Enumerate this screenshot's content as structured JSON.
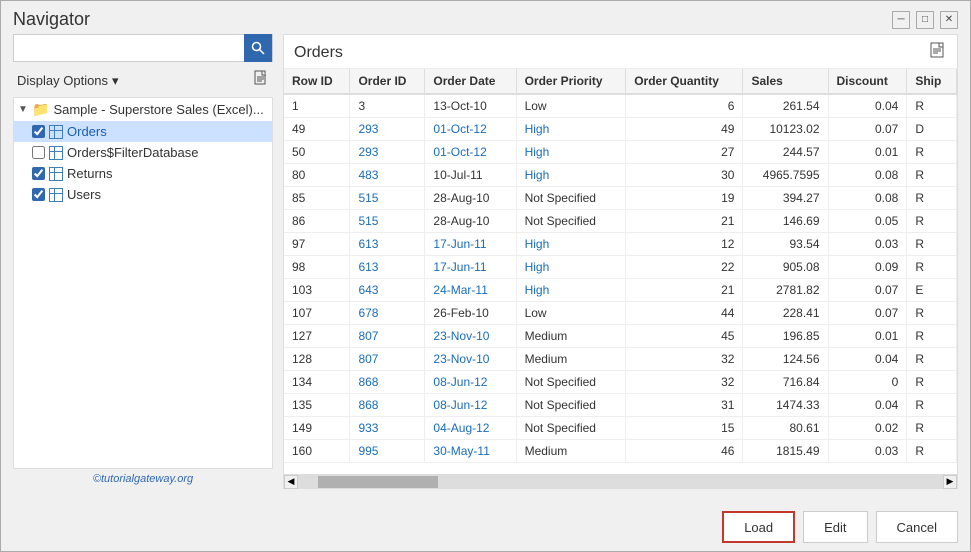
{
  "window": {
    "title": "Navigator",
    "minimize_label": "─",
    "restore_label": "□",
    "close_label": "✕"
  },
  "left_panel": {
    "search_placeholder": "",
    "display_options_label": "Display Options",
    "display_options_arrow": "▾",
    "nav_icon": "📄",
    "tree": {
      "root": {
        "label": "Sample - Superstore Sales (Excel)...",
        "expanded": true
      },
      "items": [
        {
          "id": "orders",
          "label": "Orders",
          "checked": true,
          "selected": true
        },
        {
          "id": "orders-filter",
          "label": "Orders$FilterDatabase",
          "checked": false,
          "selected": false
        },
        {
          "id": "returns",
          "label": "Returns",
          "checked": true,
          "selected": false
        },
        {
          "id": "users",
          "label": "Users",
          "checked": true,
          "selected": false
        }
      ]
    },
    "watermark": "©tutorialgateway.org"
  },
  "right_panel": {
    "title": "Orders",
    "columns": [
      "Row ID",
      "Order ID",
      "Order Date",
      "Order Priority",
      "Order Quantity",
      "Sales",
      "Discount",
      "Ship"
    ],
    "rows": [
      {
        "row_id": "1",
        "order_id": "3",
        "order_date": "13-Oct-10",
        "order_priority": "Low",
        "order_quantity": "6",
        "sales": "261.54",
        "discount": "0.04",
        "ship": "R"
      },
      {
        "row_id": "49",
        "order_id": "293",
        "order_date": "01-Oct-12",
        "order_priority": "High",
        "order_quantity": "49",
        "sales": "10123.02",
        "discount": "0.07",
        "ship": "D"
      },
      {
        "row_id": "50",
        "order_id": "293",
        "order_date": "01-Oct-12",
        "order_priority": "High",
        "order_quantity": "27",
        "sales": "244.57",
        "discount": "0.01",
        "ship": "R"
      },
      {
        "row_id": "80",
        "order_id": "483",
        "order_date": "10-Jul-11",
        "order_priority": "High",
        "order_quantity": "30",
        "sales": "4965.7595",
        "discount": "0.08",
        "ship": "R"
      },
      {
        "row_id": "85",
        "order_id": "515",
        "order_date": "28-Aug-10",
        "order_priority": "Not Specified",
        "order_quantity": "19",
        "sales": "394.27",
        "discount": "0.08",
        "ship": "R"
      },
      {
        "row_id": "86",
        "order_id": "515",
        "order_date": "28-Aug-10",
        "order_priority": "Not Specified",
        "order_quantity": "21",
        "sales": "146.69",
        "discount": "0.05",
        "ship": "R"
      },
      {
        "row_id": "97",
        "order_id": "613",
        "order_date": "17-Jun-11",
        "order_priority": "High",
        "order_quantity": "12",
        "sales": "93.54",
        "discount": "0.03",
        "ship": "R"
      },
      {
        "row_id": "98",
        "order_id": "613",
        "order_date": "17-Jun-11",
        "order_priority": "High",
        "order_quantity": "22",
        "sales": "905.08",
        "discount": "0.09",
        "ship": "R"
      },
      {
        "row_id": "103",
        "order_id": "643",
        "order_date": "24-Mar-11",
        "order_priority": "High",
        "order_quantity": "21",
        "sales": "2781.82",
        "discount": "0.07",
        "ship": "E"
      },
      {
        "row_id": "107",
        "order_id": "678",
        "order_date": "26-Feb-10",
        "order_priority": "Low",
        "order_quantity": "44",
        "sales": "228.41",
        "discount": "0.07",
        "ship": "R"
      },
      {
        "row_id": "127",
        "order_id": "807",
        "order_date": "23-Nov-10",
        "order_priority": "Medium",
        "order_quantity": "45",
        "sales": "196.85",
        "discount": "0.01",
        "ship": "R"
      },
      {
        "row_id": "128",
        "order_id": "807",
        "order_date": "23-Nov-10",
        "order_priority": "Medium",
        "order_quantity": "32",
        "sales": "124.56",
        "discount": "0.04",
        "ship": "R"
      },
      {
        "row_id": "134",
        "order_id": "868",
        "order_date": "08-Jun-12",
        "order_priority": "Not Specified",
        "order_quantity": "32",
        "sales": "716.84",
        "discount": "0",
        "ship": "R"
      },
      {
        "row_id": "135",
        "order_id": "868",
        "order_date": "08-Jun-12",
        "order_priority": "Not Specified",
        "order_quantity": "31",
        "sales": "1474.33",
        "discount": "0.04",
        "ship": "R"
      },
      {
        "row_id": "149",
        "order_id": "933",
        "order_date": "04-Aug-12",
        "order_priority": "Not Specified",
        "order_quantity": "15",
        "sales": "80.61",
        "discount": "0.02",
        "ship": "R"
      },
      {
        "row_id": "160",
        "order_id": "995",
        "order_date": "30-May-11",
        "order_priority": "Medium",
        "order_quantity": "46",
        "sales": "1815.49",
        "discount": "0.03",
        "ship": "R"
      }
    ]
  },
  "footer": {
    "load_label": "Load",
    "edit_label": "Edit",
    "cancel_label": "Cancel"
  },
  "blue_link_dates": [
    "01-Oct-12",
    "01-Oct-12",
    "17-Jun-11",
    "24-Mar-11",
    "23-Nov-10",
    "08-Jun-12",
    "04-Aug-12",
    "30-May-11"
  ],
  "blue_link_priorities": [
    "High",
    "High",
    "High",
    "High"
  ]
}
